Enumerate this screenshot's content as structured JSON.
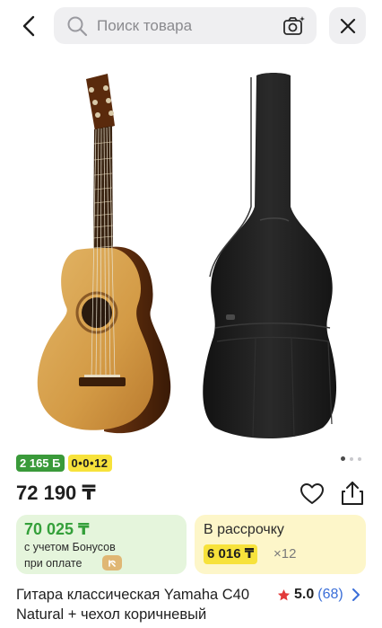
{
  "header": {
    "search_placeholder": "Поиск товара",
    "icons": [
      "back-arrow-icon",
      "search-icon",
      "camera-icon",
      "close-icon"
    ]
  },
  "gallery": {
    "images": [
      "classical-guitar-photo",
      "black-gig-bag-photo"
    ]
  },
  "badges": {
    "bonus": "2 165 Б",
    "installment": "0•0•12"
  },
  "price": {
    "current": "72 190 ₸"
  },
  "bonus_card": {
    "amount": "70 025 ₸",
    "line1": "с учетом Бонусов",
    "line2": "при оплате"
  },
  "installment_card": {
    "title": "В рассрочку",
    "monthly": "6 016 ₸",
    "months": "×12"
  },
  "product": {
    "title": "Гитара классическая Yamaha C40 Natural + чехол коричневый",
    "rating": "5.0",
    "reviews": "(68)"
  },
  "colors": {
    "bonus_green": "#34a03a",
    "installment_yellow": "#f7e23b",
    "link_blue": "#3a6ed8",
    "star_red": "#e23a3a"
  }
}
